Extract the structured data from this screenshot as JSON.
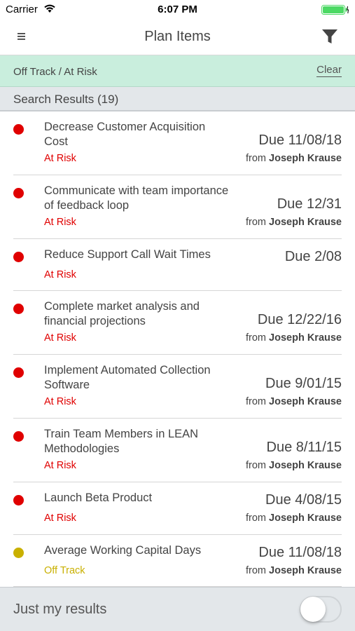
{
  "status_bar": {
    "carrier": "Carrier",
    "time": "6:07 PM"
  },
  "nav": {
    "title": "Plan Items"
  },
  "filter": {
    "label": "Off Track / At Risk",
    "clear": "Clear"
  },
  "results": {
    "label": "Search Results (19)"
  },
  "colors": {
    "at_risk": "#e00000",
    "off_track": "#c9b000",
    "battery": "#4cd964",
    "filter_bar": "#c9eedd"
  },
  "items": [
    {
      "name": "Decrease Customer Acquisition Cost",
      "status": "At Risk",
      "due": "Due 11/08/18",
      "from_prefix": "from",
      "from_name": "Joseph Krause"
    },
    {
      "name": "Communicate with team importance of feedback loop",
      "status": "At Risk",
      "due": "Due 12/31",
      "from_prefix": "from",
      "from_name": "Joseph Krause"
    },
    {
      "name": "Reduce Support Call Wait Times",
      "status": "At Risk",
      "due": "Due 2/08",
      "from_prefix": "",
      "from_name": ""
    },
    {
      "name": "Complete market analysis and financial projections",
      "status": "At Risk",
      "due": "Due 12/22/16",
      "from_prefix": "from",
      "from_name": "Joseph Krause"
    },
    {
      "name": "Implement Automated Collection Software",
      "status": "At Risk",
      "due": "Due 9/01/15",
      "from_prefix": "from",
      "from_name": "Joseph Krause"
    },
    {
      "name": "Train Team Members in LEAN Methodologies",
      "status": "At Risk",
      "due": "Due 8/11/15",
      "from_prefix": "from",
      "from_name": "Joseph Krause"
    },
    {
      "name": "Launch Beta Product",
      "status": "At Risk",
      "due": "Due 4/08/15",
      "from_prefix": "from",
      "from_name": "Joseph Krause"
    },
    {
      "name": "Average Working Capital Days",
      "status": "Off Track",
      "due": "Due 11/08/18",
      "from_prefix": "from",
      "from_name": "Joseph Krause"
    }
  ],
  "footer": {
    "label": "Just my results",
    "toggle_on": false
  }
}
